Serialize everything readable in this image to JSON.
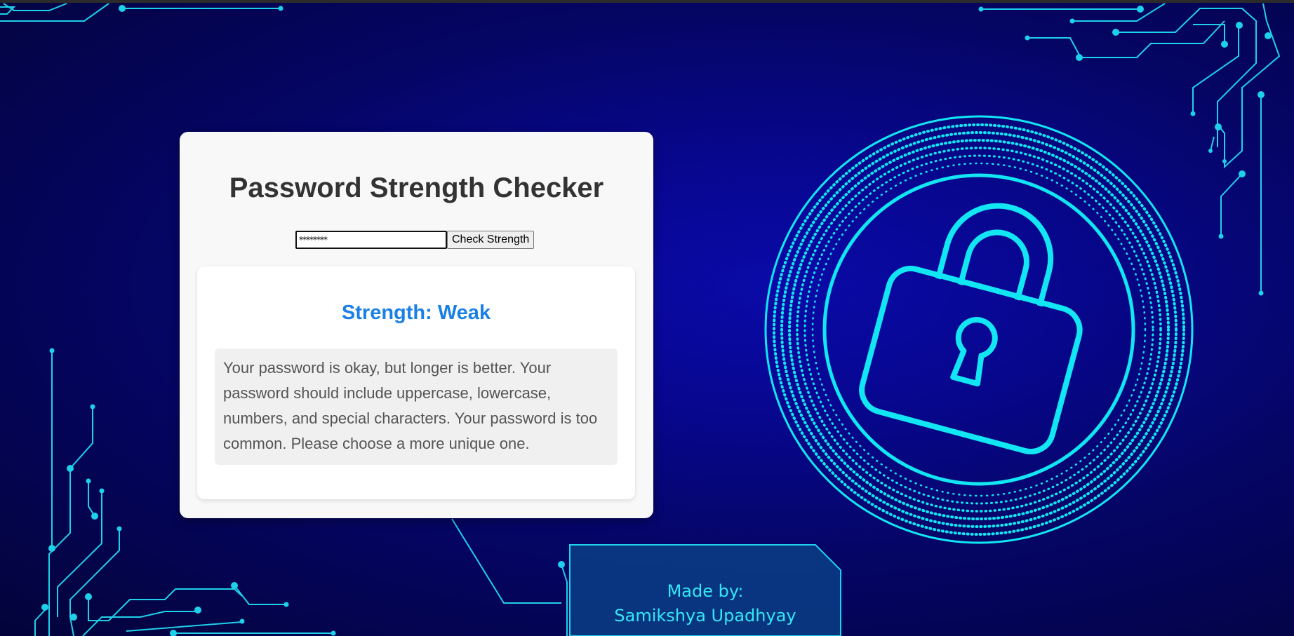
{
  "app": {
    "title": "Password Strength Checker"
  },
  "form": {
    "password_value": "********",
    "check_button_label": "Check Strength"
  },
  "result": {
    "strength_text": "Strength: Weak",
    "feedback_text": "Your password is okay, but longer is better. Your password should include uppercase, lowercase, numbers, and special characters. Your password is too common. Please choose a more unique one."
  },
  "footer": {
    "made_by_label": "Made by:",
    "author_name": "Samikshya Upadhyay"
  },
  "theme": {
    "background": "#05056b",
    "accent_cyan": "#00e5f0",
    "strength_color": "#1a7fe6",
    "title_color": "#333333"
  },
  "icons": [
    "padlock-icon",
    "circuit-lines-decoration"
  ]
}
